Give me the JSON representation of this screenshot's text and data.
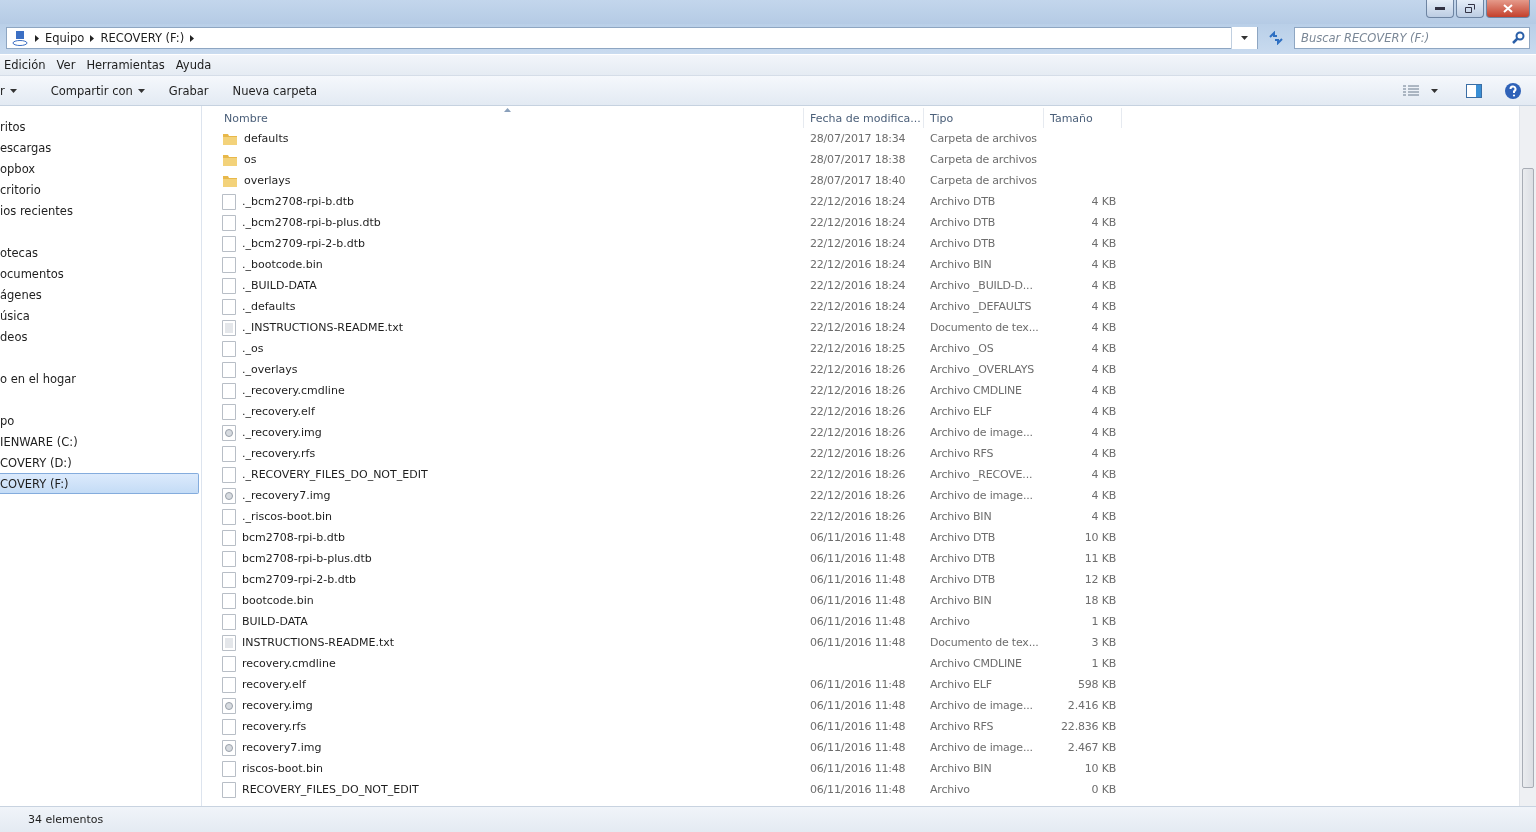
{
  "address_bar": {
    "crumbs": [
      "Equipo",
      "RECOVERY (F:)"
    ]
  },
  "search": {
    "placeholder": "Buscar RECOVERY (F:)"
  },
  "menu": [
    "Edición",
    "Ver",
    "Herramientas",
    "Ayuda"
  ],
  "toolbar": [
    {
      "label": "r",
      "dropdown": true
    },
    {
      "label": "Compartir con",
      "dropdown": true
    },
    {
      "label": "Grabar",
      "dropdown": false
    },
    {
      "label": "Nueva carpeta",
      "dropdown": false
    }
  ],
  "sidebar": {
    "groups": [
      [
        {
          "label": "ritos",
          "selected": false
        },
        {
          "label": "escargas",
          "selected": false
        },
        {
          "label": "opbox",
          "selected": false
        },
        {
          "label": "critorio",
          "selected": false
        },
        {
          "label": "ios recientes",
          "selected": false
        }
      ],
      [
        {
          "label": "otecas",
          "selected": false
        },
        {
          "label": "ocumentos",
          "selected": false
        },
        {
          "label": "ágenes",
          "selected": false
        },
        {
          "label": "úsica",
          "selected": false
        },
        {
          "label": "deos",
          "selected": false
        }
      ],
      [
        {
          "label": "o en el hogar",
          "selected": false
        }
      ],
      [
        {
          "label": "po",
          "selected": false
        },
        {
          "label": "IENWARE (C:)",
          "selected": false
        },
        {
          "label": "COVERY (D:)",
          "selected": false
        },
        {
          "label": "COVERY (F:)",
          "selected": true
        }
      ]
    ]
  },
  "table": {
    "columns": [
      "Nombre",
      "Fecha de modifica...",
      "Tipo",
      "Tamaño"
    ],
    "rows": [
      {
        "kind": "folder",
        "name": "defaults",
        "date": "28/07/2017 18:34",
        "type": "Carpeta de archivos"
      },
      {
        "kind": "folder",
        "name": "os",
        "date": "28/07/2017 18:38",
        "type": "Carpeta de archivos"
      },
      {
        "kind": "folder",
        "name": "overlays",
        "date": "28/07/2017 18:40",
        "type": "Carpeta de archivos"
      },
      {
        "kind": "file",
        "name": "._bcm2708-rpi-b.dtb",
        "date": "22/12/2016 18:24",
        "type": "Archivo DTB",
        "size": "4 KB"
      },
      {
        "kind": "file",
        "name": "._bcm2708-rpi-b-plus.dtb",
        "date": "22/12/2016 18:24",
        "type": "Archivo DTB",
        "size": "4 KB"
      },
      {
        "kind": "file",
        "name": "._bcm2709-rpi-2-b.dtb",
        "date": "22/12/2016 18:24",
        "type": "Archivo DTB",
        "size": "4 KB"
      },
      {
        "kind": "file",
        "name": "._bootcode.bin",
        "date": "22/12/2016 18:24",
        "type": "Archivo BIN",
        "size": "4 KB"
      },
      {
        "kind": "file",
        "name": "._BUILD-DATA",
        "date": "22/12/2016 18:24",
        "type": "Archivo _BUILD-D...",
        "size": "4 KB"
      },
      {
        "kind": "file",
        "name": "._defaults",
        "date": "22/12/2016 18:24",
        "type": "Archivo _DEFAULTS",
        "size": "4 KB"
      },
      {
        "kind": "text",
        "name": "._INSTRUCTIONS-README.txt",
        "date": "22/12/2016 18:24",
        "type": "Documento de tex...",
        "size": "4 KB"
      },
      {
        "kind": "file",
        "name": "._os",
        "date": "22/12/2016 18:25",
        "type": "Archivo _OS",
        "size": "4 KB"
      },
      {
        "kind": "file",
        "name": "._overlays",
        "date": "22/12/2016 18:26",
        "type": "Archivo _OVERLAYS",
        "size": "4 KB"
      },
      {
        "kind": "file",
        "name": "._recovery.cmdline",
        "date": "22/12/2016 18:26",
        "type": "Archivo CMDLINE",
        "size": "4 KB"
      },
      {
        "kind": "file",
        "name": "._recovery.elf",
        "date": "22/12/2016 18:26",
        "type": "Archivo ELF",
        "size": "4 KB"
      },
      {
        "kind": "image",
        "name": "._recovery.img",
        "date": "22/12/2016 18:26",
        "type": "Archivo de image...",
        "size": "4 KB"
      },
      {
        "kind": "file",
        "name": "._recovery.rfs",
        "date": "22/12/2016 18:26",
        "type": "Archivo RFS",
        "size": "4 KB"
      },
      {
        "kind": "file",
        "name": "._RECOVERY_FILES_DO_NOT_EDIT",
        "date": "22/12/2016 18:26",
        "type": "Archivo _RECOVE...",
        "size": "4 KB"
      },
      {
        "kind": "image",
        "name": "._recovery7.img",
        "date": "22/12/2016 18:26",
        "type": "Archivo de image...",
        "size": "4 KB"
      },
      {
        "kind": "file",
        "name": "._riscos-boot.bin",
        "date": "22/12/2016 18:26",
        "type": "Archivo BIN",
        "size": "4 KB"
      },
      {
        "kind": "file",
        "name": "bcm2708-rpi-b.dtb",
        "date": "06/11/2016 11:48",
        "type": "Archivo DTB",
        "size": "10 KB"
      },
      {
        "kind": "file",
        "name": "bcm2708-rpi-b-plus.dtb",
        "date": "06/11/2016 11:48",
        "type": "Archivo DTB",
        "size": "11 KB"
      },
      {
        "kind": "file",
        "name": "bcm2709-rpi-2-b.dtb",
        "date": "06/11/2016 11:48",
        "type": "Archivo DTB",
        "size": "12 KB"
      },
      {
        "kind": "file",
        "name": "bootcode.bin",
        "date": "06/11/2016 11:48",
        "type": "Archivo BIN",
        "size": "18 KB"
      },
      {
        "kind": "file",
        "name": "BUILD-DATA",
        "date": "06/11/2016 11:48",
        "type": "Archivo",
        "size": "1 KB"
      },
      {
        "kind": "text",
        "name": "INSTRUCTIONS-README.txt",
        "date": "06/11/2016 11:48",
        "type": "Documento de tex...",
        "size": "3 KB"
      },
      {
        "kind": "file",
        "name": "recovery.cmdline",
        "type": "Archivo CMDLINE",
        "size": "1 KB"
      },
      {
        "kind": "file",
        "name": "recovery.elf",
        "date": "06/11/2016 11:48",
        "type": "Archivo ELF",
        "size": "598 KB"
      },
      {
        "kind": "image",
        "name": "recovery.img",
        "date": "06/11/2016 11:48",
        "type": "Archivo de image...",
        "size": "2.416 KB"
      },
      {
        "kind": "file",
        "name": "recovery.rfs",
        "date": "06/11/2016 11:48",
        "type": "Archivo RFS",
        "size": "22.836 KB"
      },
      {
        "kind": "image",
        "name": "recovery7.img",
        "date": "06/11/2016 11:48",
        "type": "Archivo de image...",
        "size": "2.467 KB"
      },
      {
        "kind": "file",
        "name": "riscos-boot.bin",
        "date": "06/11/2016 11:48",
        "type": "Archivo BIN",
        "size": "10 KB"
      },
      {
        "kind": "file",
        "name": "RECOVERY_FILES_DO_NOT_EDIT",
        "date": "06/11/2016 11:48",
        "type": "Archivo",
        "size": "0 KB"
      }
    ]
  },
  "status_bar": {
    "count": "34 elementos"
  }
}
